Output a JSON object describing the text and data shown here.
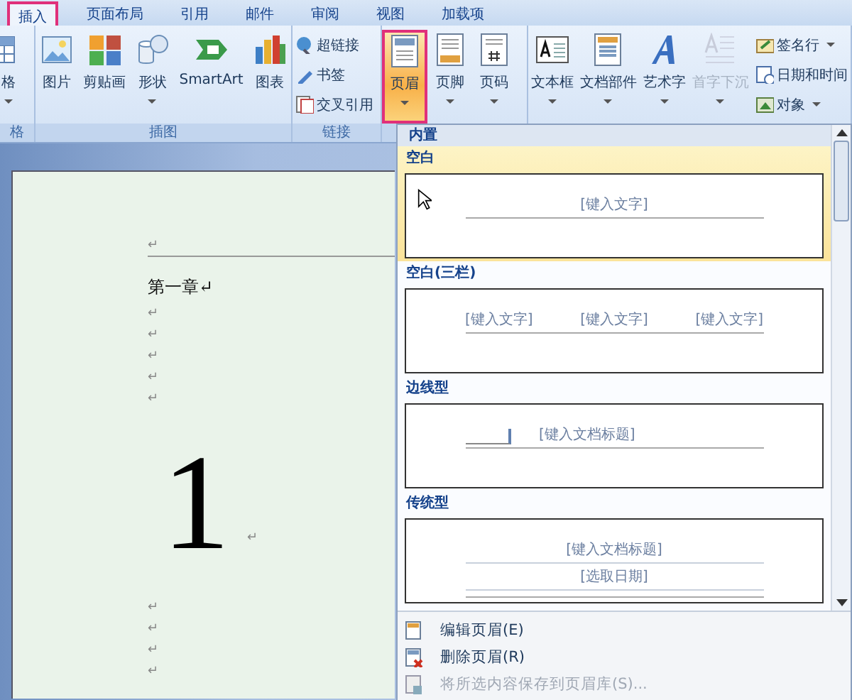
{
  "tabs": [
    {
      "label": "插入",
      "selected": true
    },
    {
      "label": "页面布局",
      "selected": false
    },
    {
      "label": "引用",
      "selected": false
    },
    {
      "label": "邮件",
      "selected": false
    },
    {
      "label": "审阅",
      "selected": false
    },
    {
      "label": "视图",
      "selected": false
    },
    {
      "label": "加载项",
      "selected": false
    }
  ],
  "ribbon": {
    "groups": [
      {
        "label": "格",
        "items": [
          {
            "kind": "large",
            "label": "格",
            "dropdown": true,
            "disabled": false,
            "pressed": false
          }
        ]
      },
      {
        "label": "插图",
        "items": [
          {
            "kind": "large",
            "label": "图片",
            "dropdown": false,
            "disabled": false,
            "pressed": false
          },
          {
            "kind": "large",
            "label": "剪贴画",
            "dropdown": false,
            "disabled": false,
            "pressed": false
          },
          {
            "kind": "large",
            "label": "形状",
            "dropdown": true,
            "disabled": false,
            "pressed": false
          },
          {
            "kind": "large",
            "label": "SmartArt",
            "dropdown": false,
            "disabled": false,
            "pressed": false
          },
          {
            "kind": "large",
            "label": "图表",
            "dropdown": false,
            "disabled": false,
            "pressed": false
          }
        ]
      },
      {
        "label": "链接",
        "items": [
          {
            "kind": "small",
            "label": "超链接",
            "dropdown": false,
            "disabled": false,
            "pressed": false
          },
          {
            "kind": "small",
            "label": "书签",
            "dropdown": false,
            "disabled": false,
            "pressed": false
          },
          {
            "kind": "small",
            "label": "交叉引用",
            "dropdown": false,
            "disabled": false,
            "pressed": false
          }
        ]
      },
      {
        "items": [
          {
            "kind": "large",
            "label": "页眉",
            "dropdown": true,
            "disabled": false,
            "pressed": true
          },
          {
            "kind": "large",
            "label": "页脚",
            "dropdown": true,
            "disabled": false,
            "pressed": false
          },
          {
            "kind": "large",
            "label": "页码",
            "dropdown": true,
            "disabled": false,
            "pressed": false
          }
        ]
      },
      {
        "items": [
          {
            "kind": "large",
            "label": "文本框",
            "dropdown": true,
            "disabled": false,
            "pressed": false
          },
          {
            "kind": "large",
            "label": "文档部件",
            "dropdown": true,
            "disabled": false,
            "pressed": false
          },
          {
            "kind": "large",
            "label": "艺术字",
            "dropdown": true,
            "disabled": false,
            "pressed": false
          },
          {
            "kind": "large",
            "label": "首字下沉",
            "dropdown": true,
            "disabled": true,
            "pressed": false
          },
          {
            "kind": "small",
            "label": "签名行",
            "dropdown": true,
            "disabled": false,
            "pressed": false
          },
          {
            "kind": "small",
            "label": "日期和时间",
            "dropdown": false,
            "disabled": false,
            "pressed": false
          },
          {
            "kind": "small",
            "label": "对象",
            "dropdown": true,
            "disabled": false,
            "pressed": false
          }
        ]
      }
    ]
  },
  "document": {
    "paragraphs": [
      {
        "kind": "mark",
        "text": "↵"
      },
      {
        "kind": "header-rule"
      },
      {
        "kind": "text",
        "text": "第一章↵"
      },
      {
        "kind": "mark",
        "text": "↵"
      },
      {
        "kind": "mark",
        "text": "↵"
      },
      {
        "kind": "mark",
        "text": "↵"
      },
      {
        "kind": "mark",
        "text": "↵"
      },
      {
        "kind": "mark",
        "text": "↵"
      },
      {
        "kind": "big",
        "text": "1",
        "mark": "↵"
      },
      {
        "kind": "mark",
        "text": "↵"
      },
      {
        "kind": "mark",
        "text": "↵"
      },
      {
        "kind": "mark",
        "text": "↵"
      },
      {
        "kind": "mark",
        "text": "↵"
      }
    ]
  },
  "gallery": {
    "heading": "内置",
    "items": [
      {
        "label": "空白",
        "kind": "blank",
        "selected": true,
        "placeholders": [
          "[键入文字]"
        ]
      },
      {
        "label": "空白(三栏)",
        "kind": "three",
        "selected": false,
        "placeholders": [
          "[键入文字]",
          "[键入文字]",
          "[键入文字]"
        ]
      },
      {
        "label": "边线型",
        "kind": "sideline",
        "selected": false,
        "placeholders": [
          "[键入文档标题]"
        ]
      },
      {
        "label": "传统型",
        "kind": "classic",
        "selected": false,
        "placeholders": [
          "[键入文档标题]",
          "[选取日期]"
        ]
      }
    ],
    "menu": [
      {
        "label": "编辑页眉(E)",
        "disabled": false
      },
      {
        "label": "删除页眉(R)",
        "disabled": false
      },
      {
        "label": "将所选内容保存到页眉库(S)...",
        "disabled": true
      }
    ]
  }
}
